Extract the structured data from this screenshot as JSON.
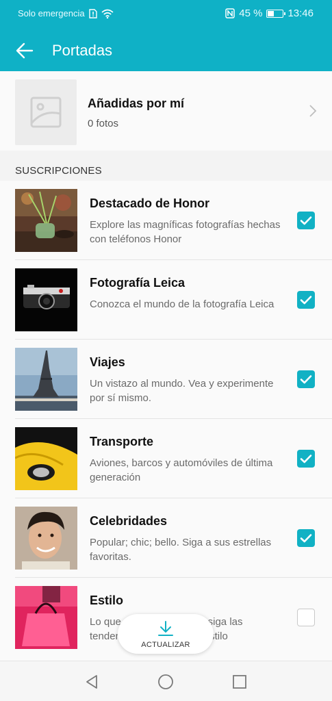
{
  "status_bar": {
    "carrier": "Solo emergencia",
    "battery": "45 %",
    "battery_level": 0.45,
    "time": "13:46",
    "icons": [
      "sim-alert-icon",
      "wifi-icon",
      "nfc-icon",
      "battery-icon"
    ]
  },
  "app_bar": {
    "title": "Portadas",
    "back_icon": "arrow-left-icon"
  },
  "mine": {
    "title": "Añadidas por mí",
    "count": "0 fotos"
  },
  "section_header": "SUSCRIPCIONES",
  "subscriptions": [
    {
      "title": "Destacado de Honor",
      "desc": "Explore las magníficas fotografías hechas con teléfonos Honor",
      "checked": true
    },
    {
      "title": "Fotografía Leica",
      "desc": "Conozca el mundo de la fotografía Leica",
      "checked": true
    },
    {
      "title": "Viajes",
      "desc": "Un vistazo al mundo. Vea y experimente por sí mismo.",
      "checked": true
    },
    {
      "title": "Transporte",
      "desc": "Aviones, barcos y automóviles de última generación",
      "checked": true
    },
    {
      "title": "Celebridades",
      "desc": "Popular; chic; bello. Siga a sus estrellas favoritas.",
      "checked": true
    },
    {
      "title": "Estilo",
      "desc": "Lo que se usa, lo que no; siga las tendencias de la moda y estilo",
      "checked": false
    }
  ],
  "update_button": {
    "label": "ACTUALIZAR",
    "icon": "download-icon"
  },
  "nav": {
    "icons": [
      "back-triangle-icon",
      "home-circle-icon",
      "recents-square-icon"
    ]
  },
  "colors": {
    "accent": "#0fb1c6",
    "checkbox": "#11b1c4"
  }
}
